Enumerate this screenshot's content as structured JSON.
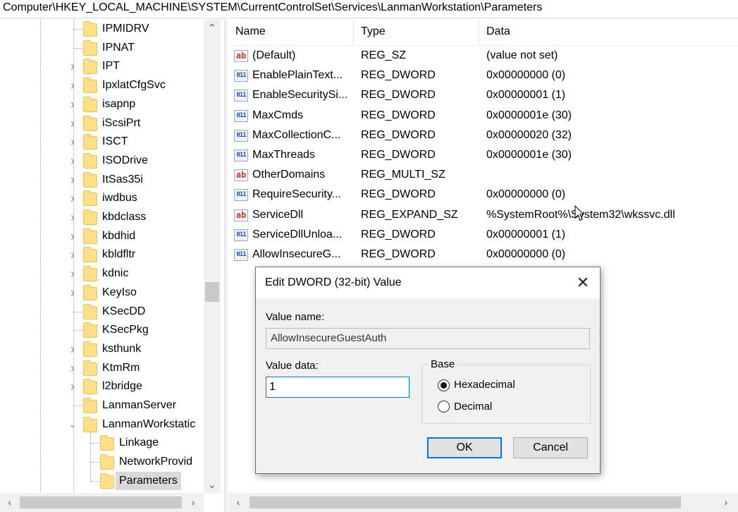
{
  "address_bar": {
    "path": "Computer\\HKEY_LOCAL_MACHINE\\SYSTEM\\CurrentControlSet\\Services\\LanmanWorkstation\\Parameters"
  },
  "tree": {
    "items": [
      {
        "label": "IPMIDRV",
        "expander": "none"
      },
      {
        "label": "IPNAT",
        "expander": "none"
      },
      {
        "label": "IPT",
        "expander": "collapsed"
      },
      {
        "label": "IpxlatCfgSvc",
        "expander": "collapsed"
      },
      {
        "label": "isapnp",
        "expander": "collapsed"
      },
      {
        "label": "iScsiPrt",
        "expander": "collapsed"
      },
      {
        "label": "ISCT",
        "expander": "collapsed"
      },
      {
        "label": "ISODrive",
        "expander": "collapsed"
      },
      {
        "label": "ItSas35i",
        "expander": "collapsed"
      },
      {
        "label": "iwdbus",
        "expander": "collapsed"
      },
      {
        "label": "kbdclass",
        "expander": "collapsed"
      },
      {
        "label": "kbdhid",
        "expander": "collapsed"
      },
      {
        "label": "kbldfltr",
        "expander": "collapsed"
      },
      {
        "label": "kdnic",
        "expander": "collapsed"
      },
      {
        "label": "KeyIso",
        "expander": "collapsed"
      },
      {
        "label": "KSecDD",
        "expander": "none"
      },
      {
        "label": "KSecPkg",
        "expander": "none"
      },
      {
        "label": "ksthunk",
        "expander": "collapsed"
      },
      {
        "label": "KtmRm",
        "expander": "collapsed"
      },
      {
        "label": "l2bridge",
        "expander": "collapsed"
      },
      {
        "label": "LanmanServer",
        "expander": "none"
      },
      {
        "label": "LanmanWorkstatic",
        "expander": "expanded"
      }
    ],
    "children": [
      {
        "label": "Linkage"
      },
      {
        "label": "NetworkProvid"
      },
      {
        "label": "Parameters",
        "selected": true
      }
    ]
  },
  "list": {
    "columns": {
      "name": "Name",
      "type": "Type",
      "data": "Data"
    },
    "rows": [
      {
        "icon": "string-value-icon",
        "name": "(Default)",
        "type": "REG_SZ",
        "data": "(value not set)"
      },
      {
        "icon": "binary-value-icon",
        "name": "EnablePlainText...",
        "type": "REG_DWORD",
        "data": "0x00000000 (0)"
      },
      {
        "icon": "binary-value-icon",
        "name": "EnableSecuritySi...",
        "type": "REG_DWORD",
        "data": "0x00000001 (1)"
      },
      {
        "icon": "binary-value-icon",
        "name": "MaxCmds",
        "type": "REG_DWORD",
        "data": "0x0000001e (30)"
      },
      {
        "icon": "binary-value-icon",
        "name": "MaxCollectionC...",
        "type": "REG_DWORD",
        "data": "0x00000020 (32)"
      },
      {
        "icon": "binary-value-icon",
        "name": "MaxThreads",
        "type": "REG_DWORD",
        "data": "0x0000001e (30)"
      },
      {
        "icon": "string-value-icon",
        "name": "OtherDomains",
        "type": "REG_MULTI_SZ",
        "data": ""
      },
      {
        "icon": "binary-value-icon",
        "name": "RequireSecurity...",
        "type": "REG_DWORD",
        "data": "0x00000000 (0)"
      },
      {
        "icon": "string-value-icon",
        "name": "ServiceDll",
        "type": "REG_EXPAND_SZ",
        "data": "%SystemRoot%\\System32\\wkssvc.dll"
      },
      {
        "icon": "binary-value-icon",
        "name": "ServiceDllUnloa...",
        "type": "REG_DWORD",
        "data": "0x00000001 (1)"
      },
      {
        "icon": "binary-value-icon",
        "name": "AllowInsecureG...",
        "type": "REG_DWORD",
        "data": "0x00000000 (0)"
      }
    ]
  },
  "dialog": {
    "title": "Edit DWORD (32-bit) Value",
    "value_name_label": "Value name:",
    "value_name": "AllowInsecureGuestAuth",
    "value_data_label": "Value data:",
    "value_data": "1",
    "base_label": "Base",
    "hex_label": "Hexadecimal",
    "dec_label": "Decimal",
    "selected_base": "hexadecimal",
    "ok_label": "OK",
    "cancel_label": "Cancel"
  },
  "colors": {
    "selection": "#d9d9d9",
    "accent": "#0078d7",
    "folder": "#ffe08a"
  }
}
